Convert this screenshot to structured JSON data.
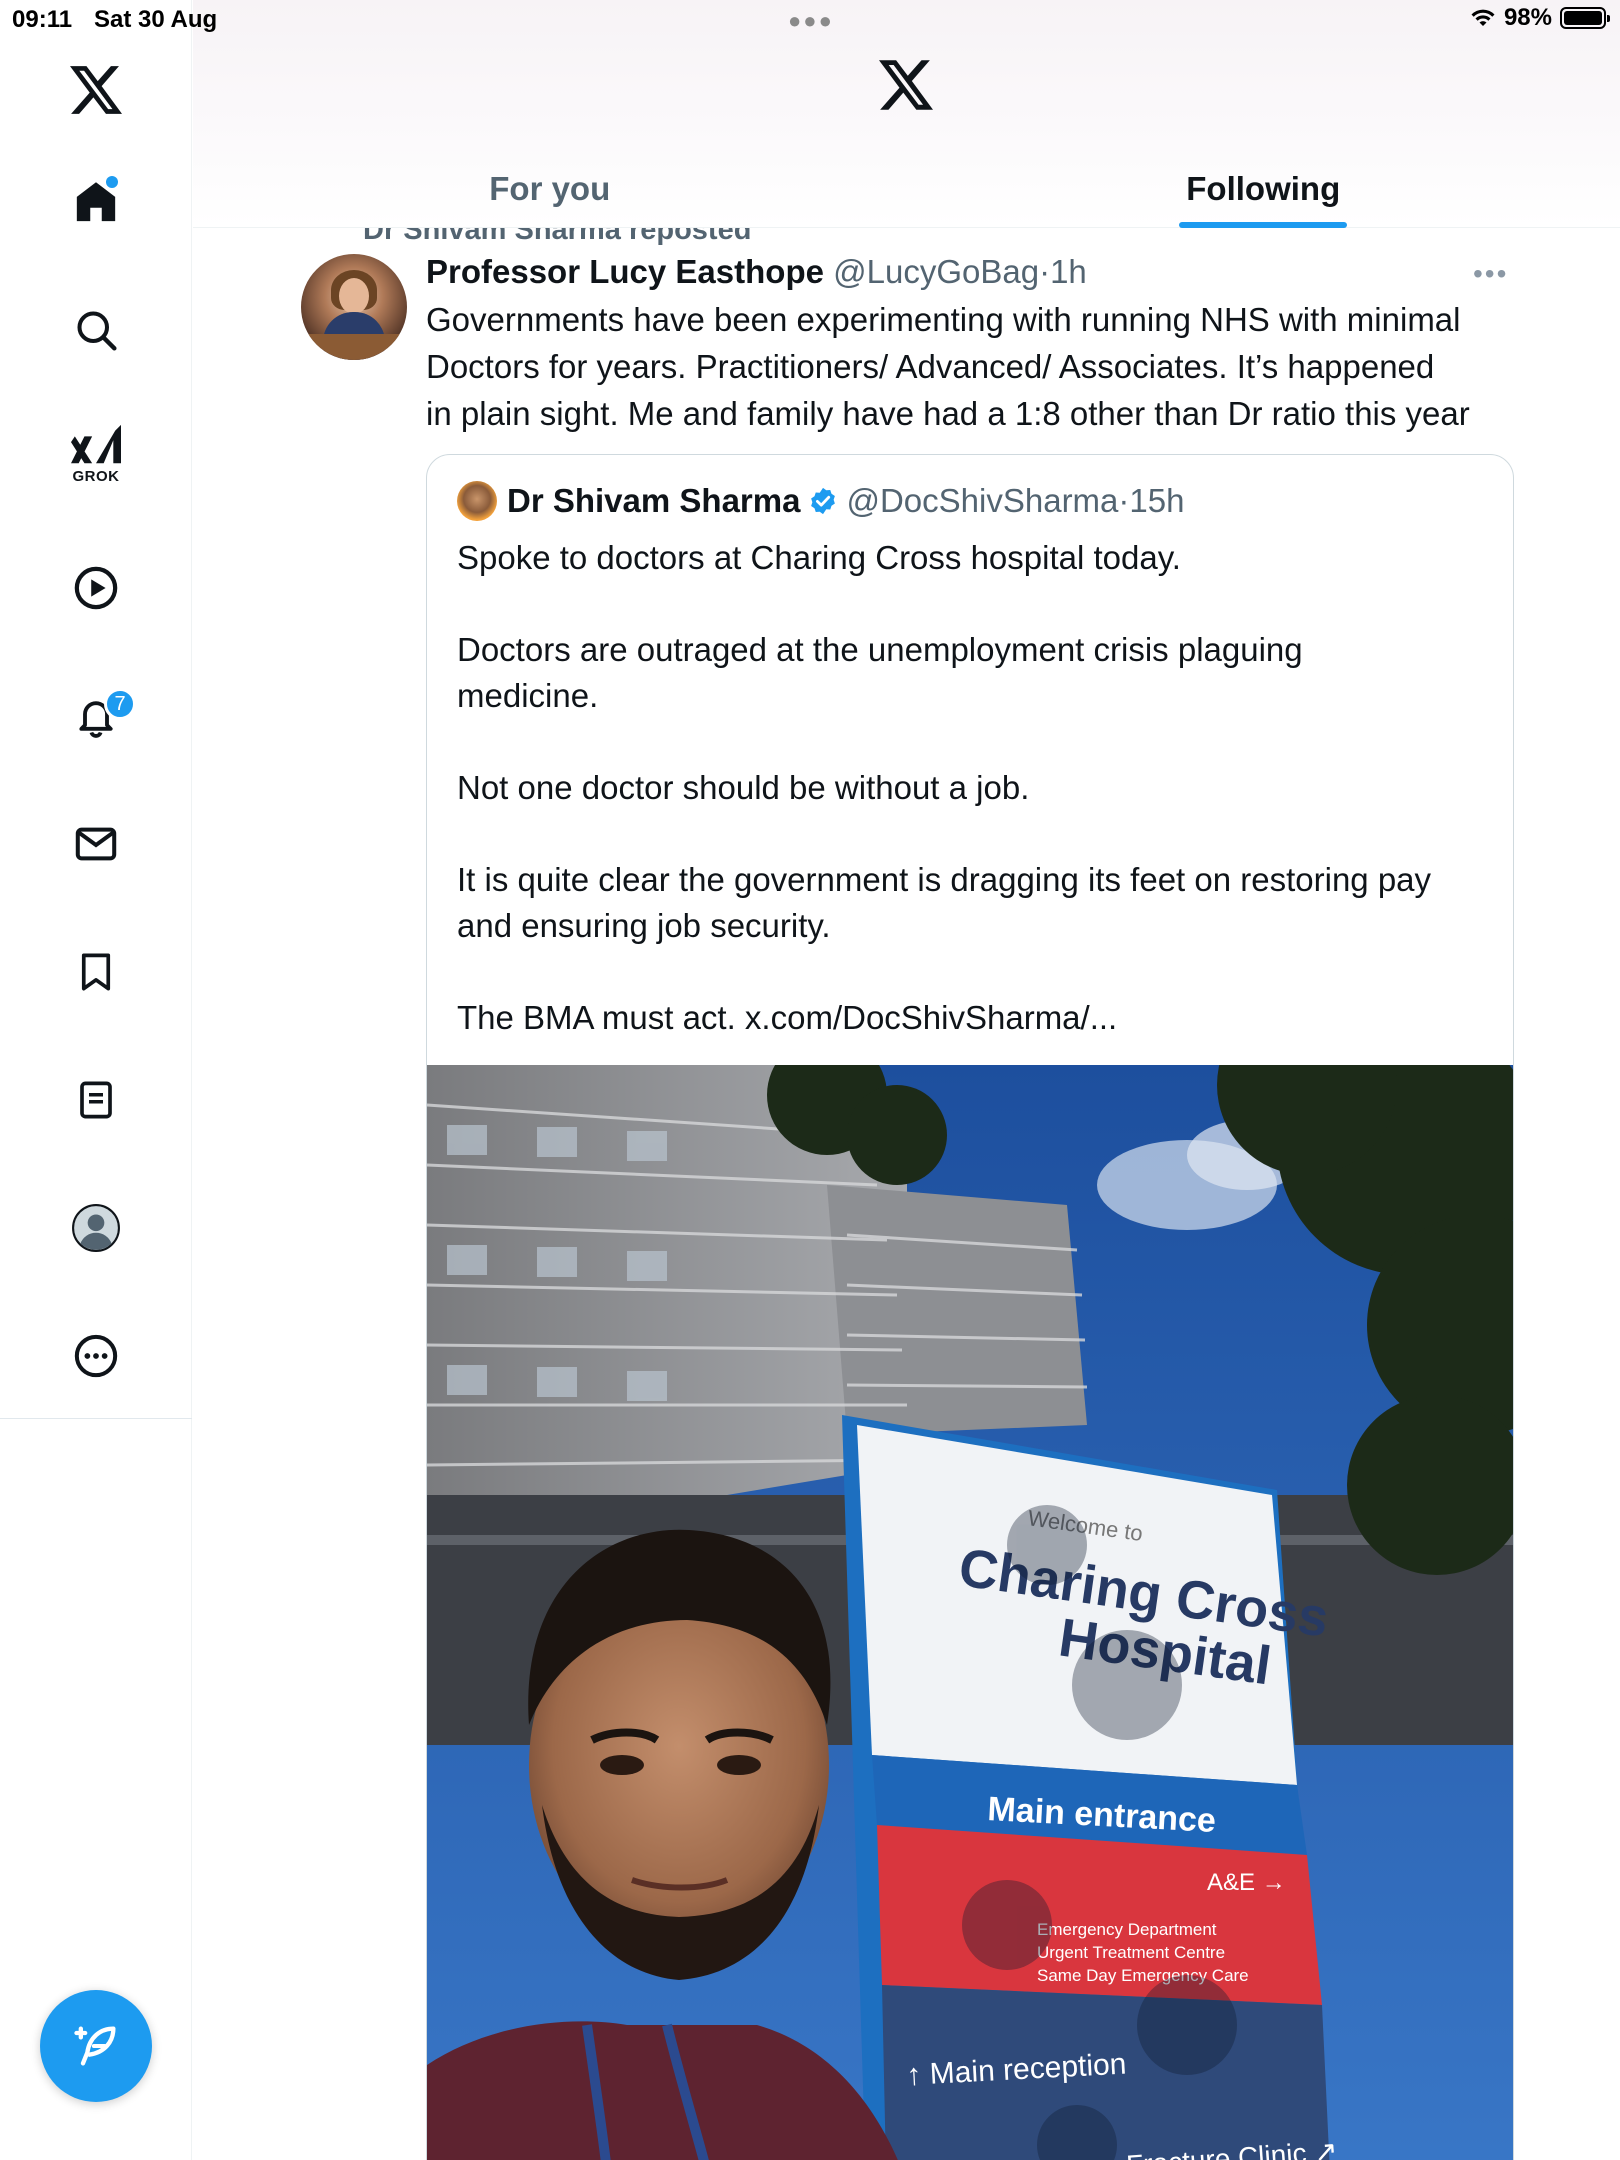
{
  "status_bar": {
    "time": "09:11",
    "date": "Sat 30 Aug",
    "battery": "98%"
  },
  "sidebar": {
    "items": [
      {
        "name": "home",
        "icon": "home-icon",
        "has_dot": true
      },
      {
        "name": "explore",
        "icon": "search-icon"
      },
      {
        "name": "grok",
        "icon": "grok-icon",
        "label": "GROK"
      },
      {
        "name": "video",
        "icon": "play-icon"
      },
      {
        "name": "notifications",
        "icon": "bell-icon",
        "badge": "7"
      },
      {
        "name": "messages",
        "icon": "mail-icon"
      },
      {
        "name": "bookmarks",
        "icon": "bookmark-icon"
      },
      {
        "name": "lists",
        "icon": "list-icon"
      },
      {
        "name": "profile",
        "icon": "avatar-icon"
      },
      {
        "name": "more",
        "icon": "more-circle-icon"
      }
    ],
    "compose_icon": "compose-feather-icon"
  },
  "header": {
    "logo": "x-logo-icon",
    "tabs": [
      {
        "label": "For you",
        "active": false
      },
      {
        "label": "Following",
        "active": true
      }
    ]
  },
  "feed": {
    "repost_banner": "Dr Shivam Sharma reposted",
    "post": {
      "author_name": "Professor Lucy Easthope",
      "handle": "@LucyGoBag",
      "separator": "·",
      "time": "1h",
      "text_lines": [
        "Governments have been experimenting with running NHS with minimal",
        "Doctors for years. Practitioners/ Advanced/ Associates. It’s happened",
        "in plain sight. Me and family have had a 1:8 other than Dr ratio this year"
      ],
      "quote": {
        "author_name": "Dr Shivam Sharma",
        "verified": true,
        "handle": "@DocShivSharma",
        "separator": "·",
        "time": "15h",
        "paragraphs": [
          "Spoke to doctors at Charing Cross hospital today.",
          "Doctors are outraged at the unemployment crisis plaguing medicine.",
          "Not one doctor should be without a job.",
          "It is quite clear the government is dragging its feet on restoring pay and ensuring job security.",
          "The BMA must act. x.com/DocShivSharma/..."
        ],
        "photo_sign": {
          "welcome": "Welcome to",
          "name_line1": "Charing Cross",
          "name_line2": "Hospital",
          "main_entrance": "Main entrance",
          "ae": "A&E →",
          "services": [
            "Emergency Department",
            "Urgent Treatment Centre",
            "Same Day Emergency Care"
          ],
          "reception": "↑ Main reception",
          "fracture": "Fracture Clinic ↗"
        }
      }
    }
  },
  "colors": {
    "accent": "#1d9bf0",
    "text": "#0f1419",
    "muted": "#536471",
    "border": "#cfd9de"
  }
}
